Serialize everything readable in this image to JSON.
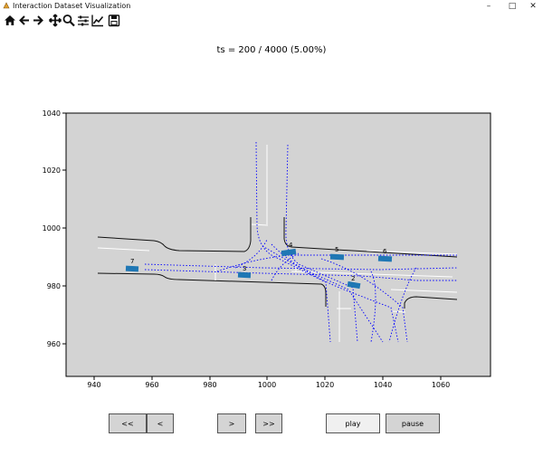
{
  "window": {
    "title": "Interaction Dataset Visualization",
    "controls": [
      "minimize-icon",
      "maximize-icon",
      "close-icon"
    ]
  },
  "toolbar": {
    "icons": [
      "home-icon",
      "back-arrow-icon",
      "forward-arrow-icon",
      "pan-icon",
      "zoom-icon",
      "configure-subplots-icon",
      "edit-axis-icon",
      "save-icon"
    ]
  },
  "plot": {
    "title": "ts = 200 / 4000 (5.00%)",
    "background_color": "#d3d3d3",
    "x_ticks": [
      "940",
      "960",
      "980",
      "1000",
      "1020",
      "1040",
      "1060"
    ],
    "y_ticks": [
      "1040",
      "1020",
      "1000",
      "980",
      "960"
    ],
    "x_range": [
      931,
      1077
    ],
    "y_range": [
      949.5,
      1040
    ],
    "vehicle_color": "#1f77b4",
    "path_color": "#0000ff",
    "vehicles": [
      {
        "id": "4",
        "x": 1008,
        "y": 991
      },
      {
        "id": "5",
        "x": 1024,
        "y": 990
      },
      {
        "id": "6",
        "x": 1041,
        "y": 989.5
      },
      {
        "id": "2",
        "x": 1030,
        "y": 980
      },
      {
        "id": "3",
        "x": 992,
        "y": 983.5
      },
      {
        "id": "7",
        "x": 953,
        "y": 986
      }
    ]
  },
  "controls": {
    "first_label": "<<",
    "prev_label": "<",
    "next_label": ">",
    "last_label": ">>",
    "play_label": "play",
    "pause_label": "pause"
  }
}
